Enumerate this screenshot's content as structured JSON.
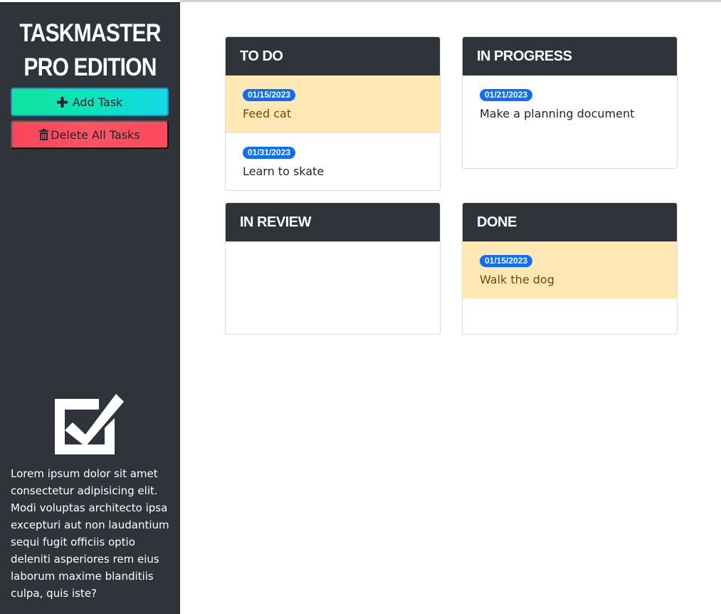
{
  "sidebar": {
    "brand_line1": "TASKMASTER",
    "brand_line2": "PRO EDITION",
    "add_task_label": "Add Task",
    "delete_all_label": "Delete All Tasks",
    "description": "Lorem ipsum dolor sit amet consectetur adipisicing elit. Modi voluptas architecto ipsa excepturi aut non laudantium sequi fugit officiis optio deleniti asperiores rem eius laborum maxime blanditiis culpa, quis iste?"
  },
  "lanes": [
    {
      "title": "TO DO",
      "tasks": [
        {
          "date": "01/15/2023",
          "title": "Feed cat",
          "status": "warning"
        },
        {
          "date": "01/31/2023",
          "title": "Learn to skate",
          "status": "normal"
        }
      ]
    },
    {
      "title": "IN PROGRESS",
      "tasks": [
        {
          "date": "01/21/2023",
          "title": "Make a planning document",
          "status": "normal"
        }
      ]
    },
    {
      "title": "IN REVIEW",
      "tasks": []
    },
    {
      "title": "DONE",
      "tasks": [
        {
          "date": "01/15/2023",
          "title": "Walk the dog",
          "status": "warning"
        }
      ]
    }
  ],
  "colors": {
    "sidebar_bg": "#2f333a",
    "add_button": "#12e39b",
    "delete_button": "#fb4458",
    "warning_card": "#ffe8b4",
    "badge": "#0d6efd"
  }
}
